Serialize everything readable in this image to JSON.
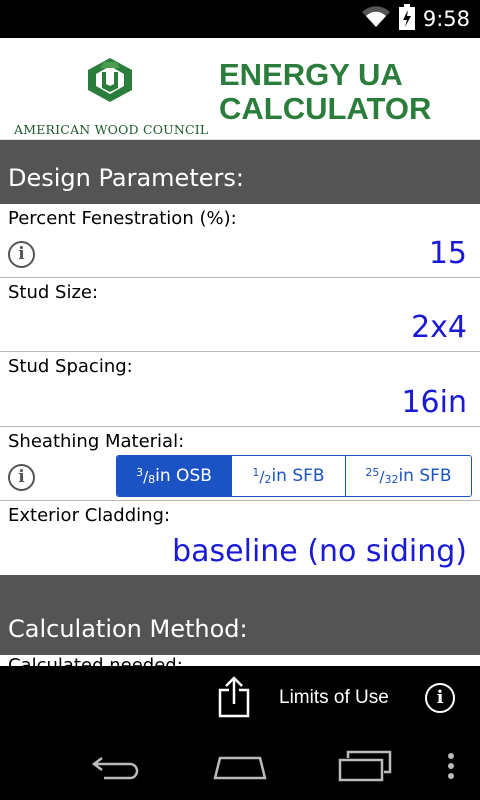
{
  "status_bar": {
    "time": "9:58",
    "icons": [
      "wifi-icon",
      "battery-charging-icon"
    ]
  },
  "header": {
    "org_name": "AMERICAN WOOD COUNCIL",
    "title_line1": "ENERGY UA",
    "title_line2": "CALCULATOR",
    "brand_color": "#2a7d3a"
  },
  "sections": {
    "design": {
      "title": "Design Parameters:"
    },
    "calc": {
      "title": "Calculation Method:",
      "partial_label": "Calculated needed:"
    }
  },
  "fields": {
    "fenestration": {
      "label": "Percent Fenestration (%):",
      "value": "15"
    },
    "stud_size": {
      "label": "Stud Size:",
      "value": "2x4"
    },
    "stud_spacing": {
      "label": "Stud Spacing:",
      "value": "16in"
    },
    "sheathing": {
      "label": "Sheathing Material:",
      "options": [
        {
          "num": "3",
          "den": "8",
          "text": "in OSB",
          "selected": true
        },
        {
          "num": "1",
          "den": "2",
          "text": "in SFB",
          "selected": false
        },
        {
          "num": "25",
          "den": "32",
          "text": "in SFB",
          "selected": false
        }
      ]
    },
    "cladding": {
      "label": "Exterior Cladding:",
      "value": "baseline (no siding)"
    }
  },
  "action_bar": {
    "limits_label": "Limits of Use"
  },
  "colors": {
    "section_bg": "#545454",
    "value_blue": "#1a1ad6",
    "segment_blue": "#1b52c4"
  }
}
